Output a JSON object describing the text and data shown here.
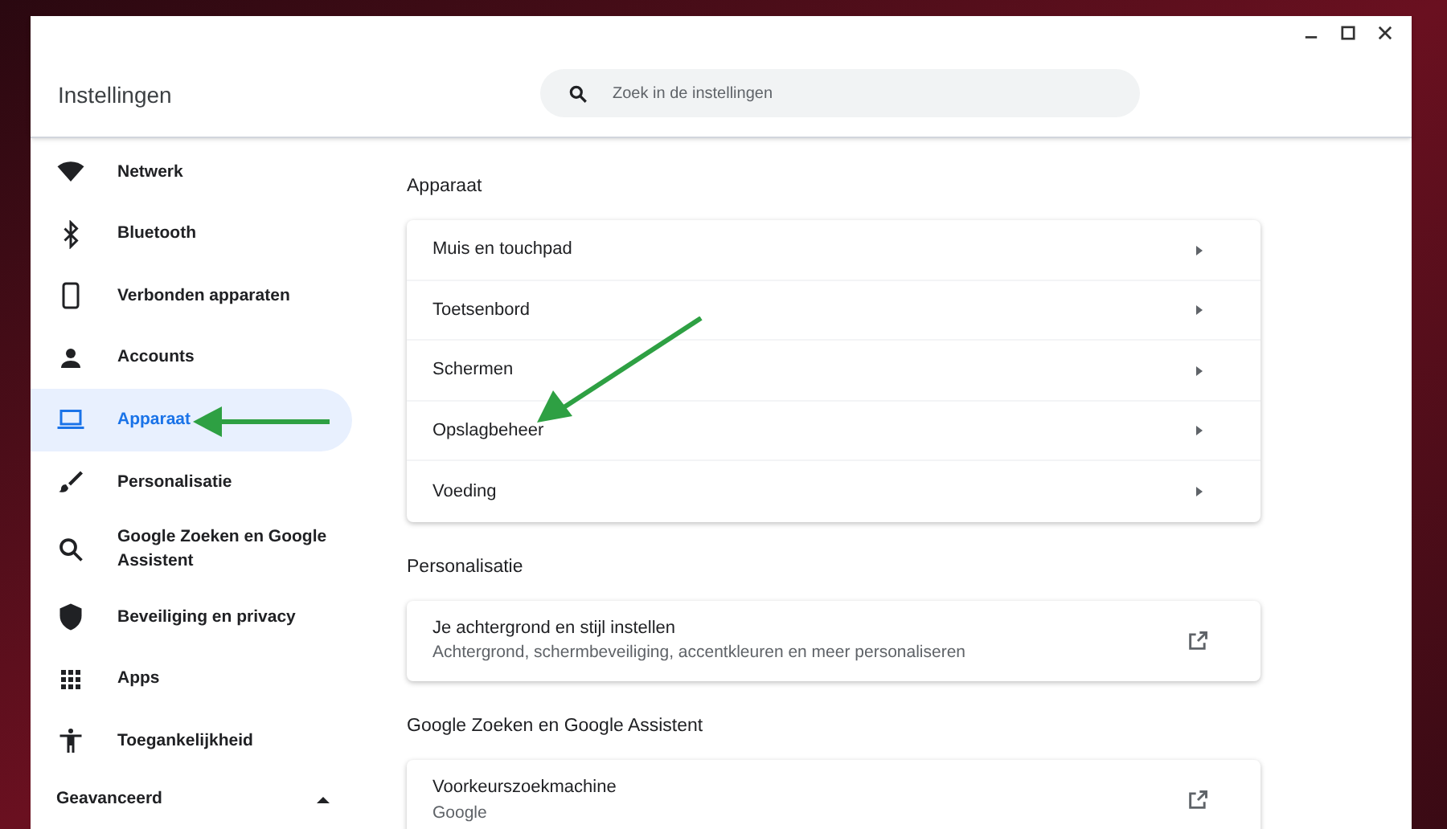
{
  "window": {
    "title": "Instellingen"
  },
  "search": {
    "placeholder": "Zoek in de instellingen"
  },
  "sidebar": {
    "items": [
      {
        "label": "Netwerk",
        "selected": false
      },
      {
        "label": "Bluetooth",
        "selected": false
      },
      {
        "label": "Verbonden apparaten",
        "selected": false
      },
      {
        "label": "Accounts",
        "selected": false
      },
      {
        "label": "Apparaat",
        "selected": true
      },
      {
        "label": "Personalisatie",
        "selected": false
      },
      {
        "label": "Google Zoeken en Google Assistent",
        "selected": false
      },
      {
        "label": "Beveiliging en privacy",
        "selected": false
      },
      {
        "label": "Apps",
        "selected": false
      },
      {
        "label": "Toegankelijkheid",
        "selected": false
      }
    ],
    "advanced": {
      "label": "Geavanceerd",
      "expanded": true
    }
  },
  "sections": [
    {
      "title": "Apparaat",
      "rows": [
        {
          "kind": "submenu",
          "label": "Muis en touchpad"
        },
        {
          "kind": "submenu",
          "label": "Toetsenbord"
        },
        {
          "kind": "submenu",
          "label": "Schermen"
        },
        {
          "kind": "submenu",
          "label": "Opslagbeheer"
        },
        {
          "kind": "submenu",
          "label": "Voeding"
        }
      ]
    },
    {
      "title": "Personalisatie",
      "rows": [
        {
          "kind": "external",
          "label": "Je achtergrond en stijl instellen",
          "subtitle": "Achtergrond, schermbeveiliging, accentkleuren en meer personaliseren"
        }
      ]
    },
    {
      "title": "Google Zoeken en Google Assistent",
      "rows": [
        {
          "kind": "external",
          "label": "Voorkeurszoekmachine",
          "subtitle": "Google"
        }
      ]
    }
  ]
}
